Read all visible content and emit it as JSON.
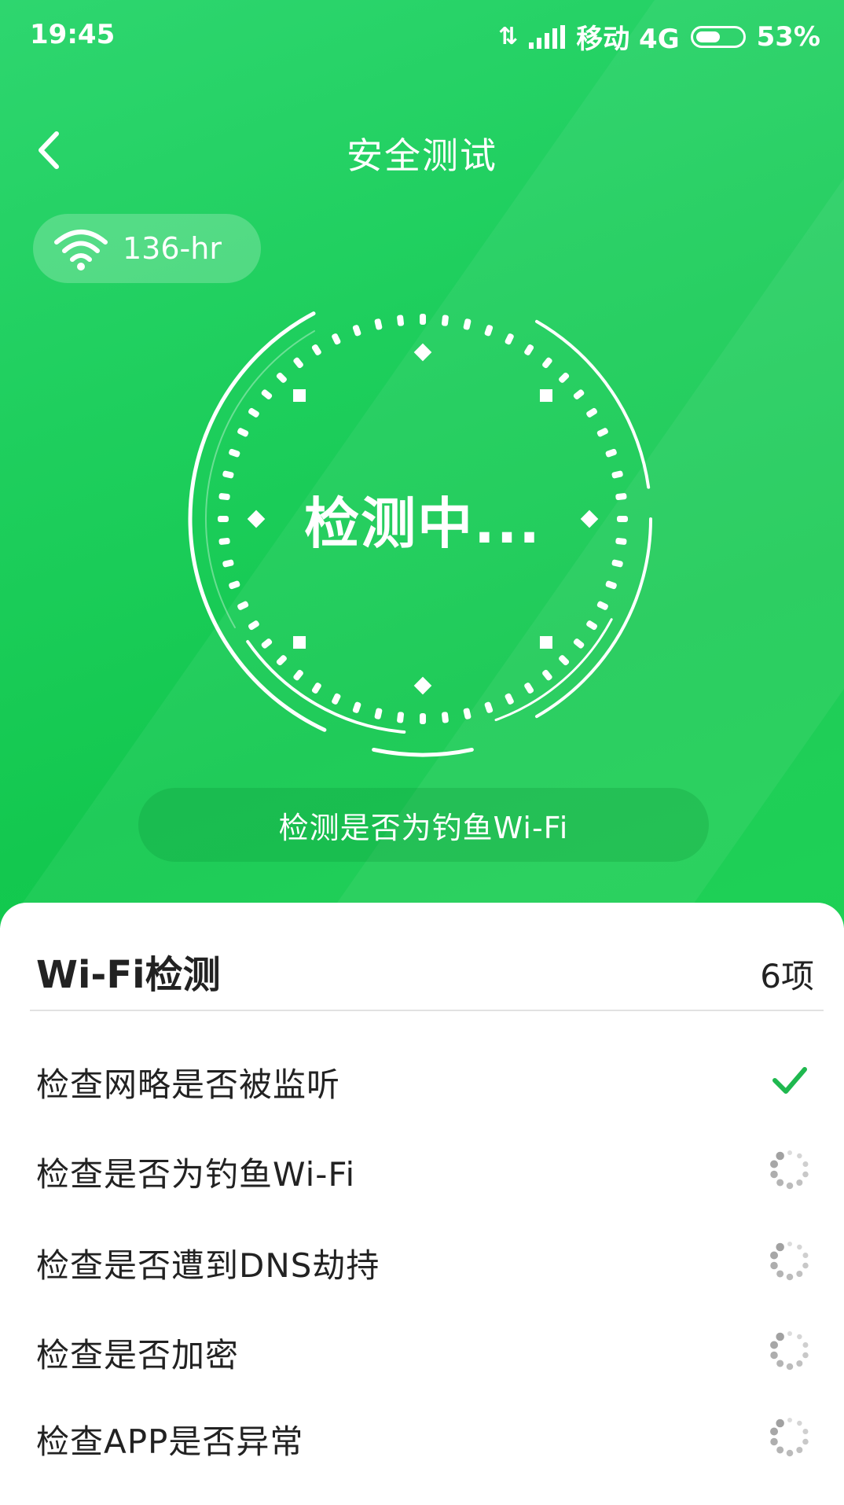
{
  "status_bar": {
    "time": "19:45",
    "carrier": "移动 4G",
    "battery": "53%",
    "battery_level": 0.53
  },
  "nav": {
    "title": "安全测试",
    "back_icon": "chevron-left-icon"
  },
  "wifi": {
    "name": "136-hr",
    "icon": "wifi-icon"
  },
  "dial": {
    "status_text": "检测中..."
  },
  "current_step": "检测是否为钓鱼Wi-Fi",
  "panel": {
    "title": "Wi-Fi检测",
    "count": "6项",
    "items": [
      {
        "label": "检查网略是否被监听",
        "state": "done",
        "icon": "checkmark-icon"
      },
      {
        "label": "检查是否为钓鱼Wi-Fi",
        "state": "loading",
        "icon": "spinner-icon"
      },
      {
        "label": "检查是否遭到DNS劫持",
        "state": "loading",
        "icon": "spinner-icon"
      },
      {
        "label": "检查是否加密",
        "state": "loading",
        "icon": "spinner-icon"
      },
      {
        "label": "检查APP是否异常",
        "state": "loading",
        "icon": "spinner-icon"
      }
    ]
  },
  "colors": {
    "accent": "#13c84f",
    "check": "#1fb84f",
    "spinner": "#9a9a9a"
  }
}
